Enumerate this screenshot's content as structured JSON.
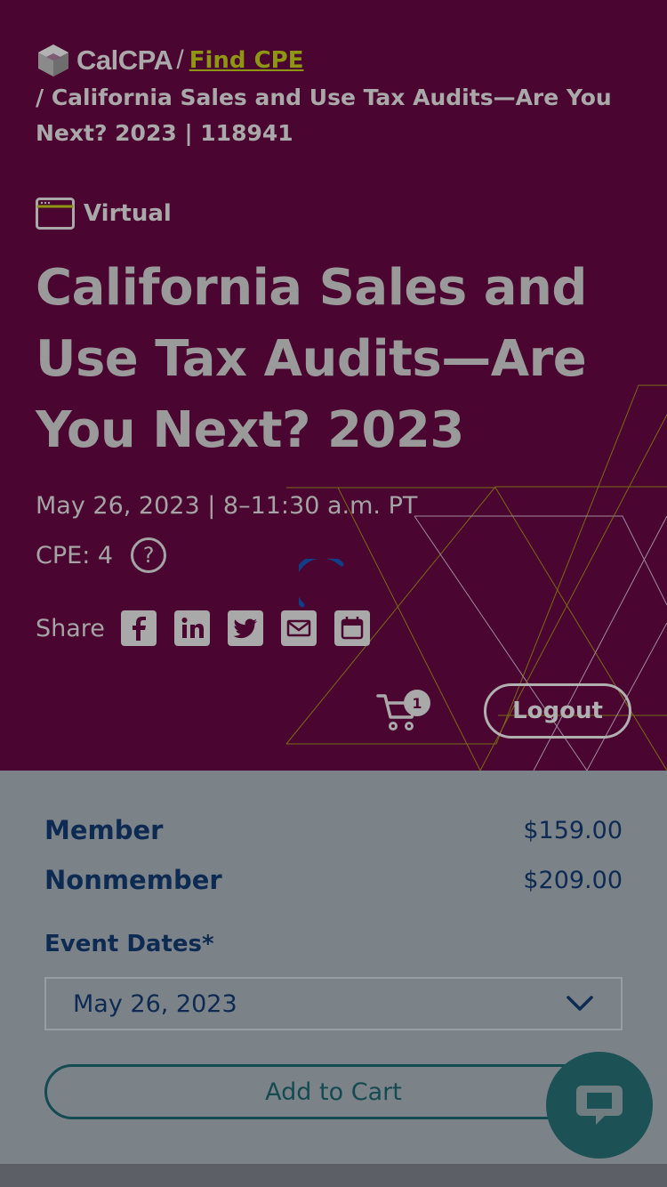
{
  "breadcrumb": {
    "logo_text": "CalCPA",
    "sep": "/",
    "link_label": "Find CPE",
    "current": "/ California Sales and Use Tax Audits—Are You Next? 2023 | 118941"
  },
  "event": {
    "format_label": "Virtual",
    "title": "California Sales and Use Tax Audits—Are You Next? 2023",
    "date_time": "May 26, 2023 | 8–11:30 a.m. PT",
    "cpe_label": "CPE: 4",
    "help_glyph": "?"
  },
  "share": {
    "label": "Share",
    "buttons": [
      "facebook-icon",
      "linkedin-icon",
      "twitter-icon",
      "email-icon",
      "calendar-icon"
    ]
  },
  "header_actions": {
    "cart_count": "1",
    "logout_label": "Logout"
  },
  "pricing": {
    "rows": [
      {
        "label": "Member",
        "price": "$159.00"
      },
      {
        "label": "Nonmember",
        "price": "$209.00"
      }
    ],
    "dates_label": "Event Dates*",
    "selected_date": "May 26, 2023",
    "add_to_cart_label": "Add to Cart"
  },
  "colors": {
    "hero_bg": "#4a0530",
    "link_accent": "#8e9612",
    "navy_text": "#0d2a52",
    "teal": "#144a52"
  }
}
